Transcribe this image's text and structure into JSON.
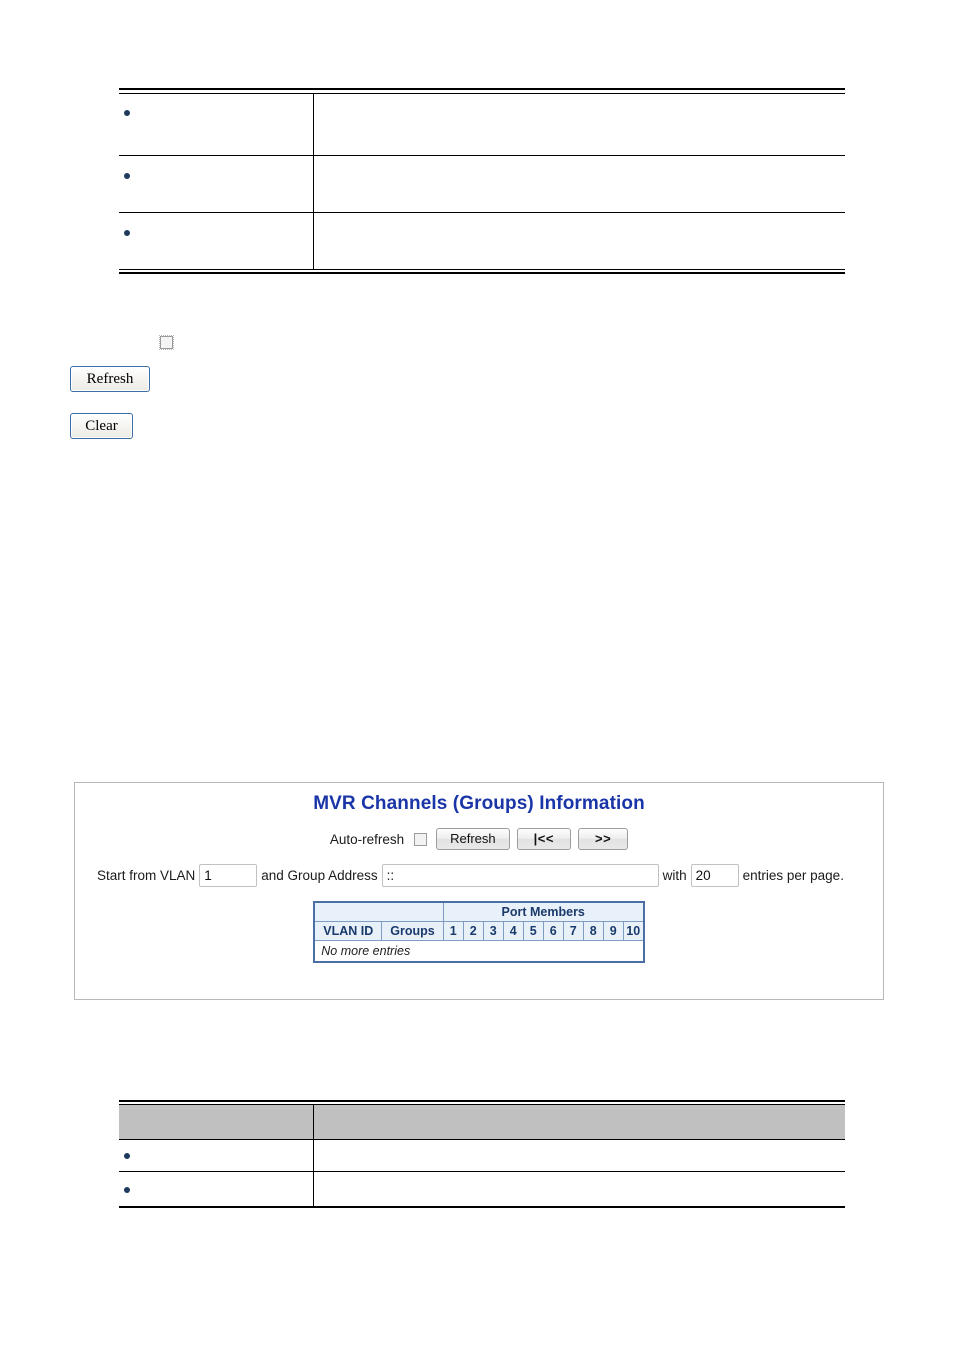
{
  "document": {
    "top_table": {
      "rows": [
        {
          "term": "",
          "description": ""
        },
        {
          "term": "",
          "description": ""
        },
        {
          "term": "",
          "description": ""
        }
      ]
    },
    "controls": {
      "auto_refresh_checked": false,
      "refresh_label": "Refresh",
      "clear_label": "Clear"
    },
    "bottom_table": {
      "header": {
        "col1": "",
        "col2": ""
      },
      "rows": [
        {
          "term": "",
          "description": ""
        },
        {
          "term": "",
          "description": ""
        }
      ]
    }
  },
  "mvr_panel": {
    "title": "MVR Channels (Groups) Information",
    "toolbar": {
      "auto_refresh_label": "Auto-refresh",
      "auto_refresh_checked": false,
      "refresh_label": "Refresh",
      "first_page_label": "|<<",
      "next_page_label": ">>"
    },
    "filters": {
      "start_from_vlan_label": "Start from VLAN",
      "vlan_value": "1",
      "and_group_address_label": "and Group Address",
      "group_address_value": "::",
      "with_label": "with",
      "entries_value": "20",
      "entries_per_page_label": "entries per page."
    },
    "table": {
      "group_header": "Port Members",
      "columns": [
        "VLAN ID",
        "Groups"
      ],
      "port_columns": [
        "1",
        "2",
        "3",
        "4",
        "5",
        "6",
        "7",
        "8",
        "9",
        "10"
      ],
      "empty_message": "No more entries",
      "rows": []
    }
  },
  "colors": {
    "title_blue": "#1a35a8",
    "table_border_blue": "#4a6fa5",
    "table_header_bg": "#e8f1fa",
    "bullet_navy": "#1f3a5f",
    "header_gray": "#c0c0c0"
  }
}
